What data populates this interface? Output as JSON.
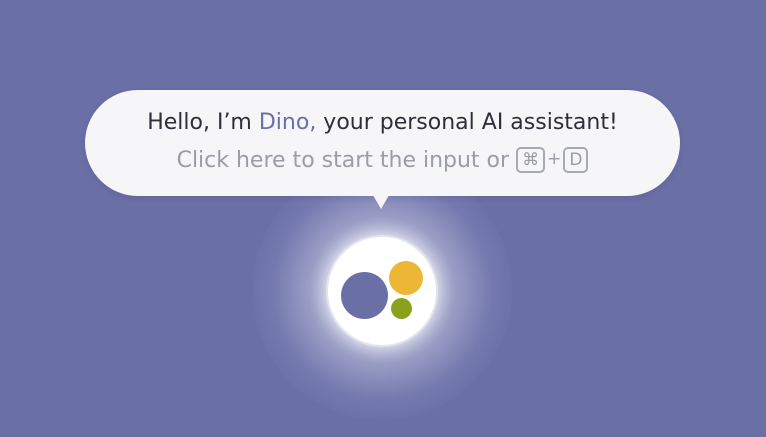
{
  "greeting": {
    "prefix": "Hello, I’m ",
    "name": "Dino,",
    "suffix": " your personal AI assistant!"
  },
  "hint": {
    "text": "Click here to start the input or ",
    "shortcut_key1": "⌘",
    "shortcut_plus": "+",
    "shortcut_key2": "D"
  },
  "colors": {
    "background": "#6a6fa6",
    "accent": "#6a6fa6",
    "dot_yellow": "#edb736",
    "dot_green": "#8aa11b"
  },
  "icons": {
    "assistant_logo": "dino-logo-icon"
  }
}
